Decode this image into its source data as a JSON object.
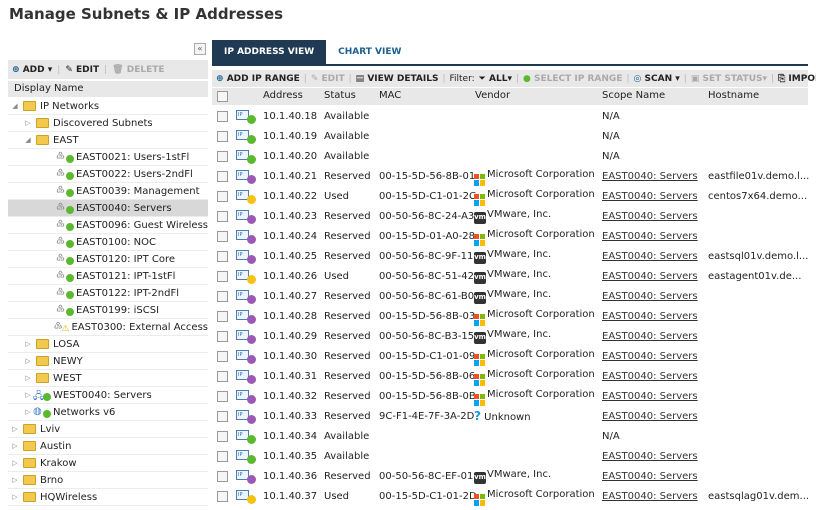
{
  "title": "Manage Subnets & IP Addresses",
  "colors": {
    "available": "#5cb82e",
    "reserved": "#9b59b6",
    "used": "#f5c211",
    "header_dark": "#1f3a52"
  },
  "left": {
    "collapse": "«",
    "toolbar": {
      "add": "ADD",
      "edit": "EDIT",
      "delete": "DELETE"
    },
    "column": "Display Name",
    "tree": [
      {
        "label": "IP Networks",
        "level": 0,
        "type": "folder",
        "expanded": true
      },
      {
        "label": "Discovered Subnets",
        "level": 1,
        "type": "folder"
      },
      {
        "label": "EAST",
        "level": 1,
        "type": "folder",
        "expanded": true
      },
      {
        "label": "EAST0021: Users-1stFl",
        "level": 2,
        "type": "subnet",
        "status": "ok"
      },
      {
        "label": "EAST0022: Users-2ndFl",
        "level": 2,
        "type": "subnet",
        "status": "ok"
      },
      {
        "label": "EAST0039: Management",
        "level": 2,
        "type": "subnet",
        "status": "ok"
      },
      {
        "label": "EAST0040: Servers",
        "level": 2,
        "type": "subnet",
        "status": "ok",
        "selected": true
      },
      {
        "label": "EAST0096: Guest Wireless",
        "level": 2,
        "type": "subnet",
        "status": "ok"
      },
      {
        "label": "EAST0100: NOC",
        "level": 2,
        "type": "subnet",
        "status": "ok"
      },
      {
        "label": "EAST0120: IPT Core",
        "level": 2,
        "type": "subnet",
        "status": "ok"
      },
      {
        "label": "EAST0121: IPT-1stFl",
        "level": 2,
        "type": "subnet",
        "status": "ok"
      },
      {
        "label": "EAST0122: IPT-2ndFl",
        "level": 2,
        "type": "subnet",
        "status": "ok"
      },
      {
        "label": "EAST0199: iSCSI",
        "level": 2,
        "type": "subnet",
        "status": "ok"
      },
      {
        "label": "EAST0300: External Access",
        "level": 2,
        "type": "subnet",
        "status": "warning"
      },
      {
        "label": "LOSA",
        "level": 1,
        "type": "folder"
      },
      {
        "label": "NEWY",
        "level": 1,
        "type": "folder"
      },
      {
        "label": "WEST",
        "level": 1,
        "type": "folder"
      },
      {
        "label": "WEST0040: Servers",
        "level": 1,
        "type": "server",
        "status": "ok"
      },
      {
        "label": "Networks v6",
        "level": 1,
        "type": "globe",
        "status": "ok"
      },
      {
        "label": "Lviv",
        "level": 0,
        "type": "folder"
      },
      {
        "label": "Austin",
        "level": 0,
        "type": "folder"
      },
      {
        "label": "Krakow",
        "level": 0,
        "type": "folder"
      },
      {
        "label": "Brno",
        "level": 0,
        "type": "folder"
      },
      {
        "label": "HQWireless",
        "level": 0,
        "type": "folder"
      }
    ]
  },
  "tabs": [
    "IP ADDRESS VIEW",
    "CHART VIEW"
  ],
  "toolbar": {
    "add_range": "ADD IP RANGE",
    "edit": "EDIT",
    "view_details": "VIEW DETAILS",
    "filter_label": "Filter:",
    "filter_value": "ALL",
    "select_range": "SELECT IP RANGE",
    "scan": "SCAN",
    "set_status": "SET STATUS",
    "import": "IMPORT"
  },
  "columns": [
    "Address",
    "Status",
    "MAC",
    "Vendor",
    "Scope Name",
    "Hostname"
  ],
  "rows": [
    {
      "address": "10.1.40.18",
      "status": "Available",
      "mac": "",
      "vendor": "",
      "vendor_icon": "",
      "scope": "N/A",
      "hostname": ""
    },
    {
      "address": "10.1.40.19",
      "status": "Available",
      "mac": "",
      "vendor": "",
      "vendor_icon": "",
      "scope": "N/A",
      "hostname": ""
    },
    {
      "address": "10.1.40.20",
      "status": "Available",
      "mac": "",
      "vendor": "",
      "vendor_icon": "",
      "scope": "N/A",
      "hostname": ""
    },
    {
      "address": "10.1.40.21",
      "status": "Reserved",
      "mac": "00-15-5D-56-8B-01",
      "vendor": "Microsoft Corporation",
      "vendor_icon": "microsoft",
      "scope": "EAST0040: Servers",
      "hostname": "eastfile01v.demo.l..."
    },
    {
      "address": "10.1.40.22",
      "status": "Used",
      "mac": "00-15-5D-C1-01-2C",
      "vendor": "Microsoft Corporation",
      "vendor_icon": "microsoft",
      "scope": "EAST0040: Servers",
      "hostname": "centos7x64.demo..."
    },
    {
      "address": "10.1.40.23",
      "status": "Reserved",
      "mac": "00-50-56-8C-24-A3",
      "vendor": "VMware, Inc.",
      "vendor_icon": "vmware",
      "scope": "EAST0040: Servers",
      "hostname": ""
    },
    {
      "address": "10.1.40.24",
      "status": "Reserved",
      "mac": "00-15-5D-01-A0-28",
      "vendor": "Microsoft Corporation",
      "vendor_icon": "microsoft",
      "scope": "EAST0040: Servers",
      "hostname": ""
    },
    {
      "address": "10.1.40.25",
      "status": "Reserved",
      "mac": "00-50-56-8C-9F-11",
      "vendor": "VMware, Inc.",
      "vendor_icon": "vmware",
      "scope": "EAST0040: Servers",
      "hostname": "eastsql01v.demo.l..."
    },
    {
      "address": "10.1.40.26",
      "status": "Used",
      "mac": "00-50-56-8C-51-42",
      "vendor": "VMware, Inc.",
      "vendor_icon": "vmware",
      "scope": "EAST0040: Servers",
      "hostname": "eastagent01v.de..."
    },
    {
      "address": "10.1.40.27",
      "status": "Reserved",
      "mac": "00-50-56-8C-61-B0",
      "vendor": "VMware, Inc.",
      "vendor_icon": "vmware",
      "scope": "EAST0040: Servers",
      "hostname": ""
    },
    {
      "address": "10.1.40.28",
      "status": "Reserved",
      "mac": "00-15-5D-56-8B-03",
      "vendor": "Microsoft Corporation",
      "vendor_icon": "microsoft",
      "scope": "EAST0040: Servers",
      "hostname": ""
    },
    {
      "address": "10.1.40.29",
      "status": "Reserved",
      "mac": "00-50-56-8C-B3-15",
      "vendor": "VMware, Inc.",
      "vendor_icon": "vmware",
      "scope": "EAST0040: Servers",
      "hostname": ""
    },
    {
      "address": "10.1.40.30",
      "status": "Reserved",
      "mac": "00-15-5D-C1-01-09",
      "vendor": "Microsoft Corporation",
      "vendor_icon": "microsoft",
      "scope": "EAST0040: Servers",
      "hostname": ""
    },
    {
      "address": "10.1.40.31",
      "status": "Reserved",
      "mac": "00-15-5D-56-8B-06",
      "vendor": "Microsoft Corporation",
      "vendor_icon": "microsoft",
      "scope": "EAST0040: Servers",
      "hostname": ""
    },
    {
      "address": "10.1.40.32",
      "status": "Reserved",
      "mac": "00-15-5D-56-8B-0B",
      "vendor": "Microsoft Corporation",
      "vendor_icon": "microsoft",
      "scope": "EAST0040: Servers",
      "hostname": ""
    },
    {
      "address": "10.1.40.33",
      "status": "Reserved",
      "mac": "9C-F1-4E-7F-3A-2D",
      "vendor": "Unknown",
      "vendor_icon": "unknown",
      "scope": "EAST0040: Servers",
      "hostname": ""
    },
    {
      "address": "10.1.40.34",
      "status": "Available",
      "mac": "",
      "vendor": "",
      "vendor_icon": "",
      "scope": "N/A",
      "hostname": ""
    },
    {
      "address": "10.1.40.35",
      "status": "Available",
      "mac": "",
      "vendor": "",
      "vendor_icon": "",
      "scope": "EAST0040: Servers",
      "hostname": ""
    },
    {
      "address": "10.1.40.36",
      "status": "Reserved",
      "mac": "00-50-56-8C-EF-01",
      "vendor": "VMware, Inc.",
      "vendor_icon": "vmware",
      "scope": "EAST0040: Servers",
      "hostname": ""
    },
    {
      "address": "10.1.40.37",
      "status": "Used",
      "mac": "00-15-5D-C1-01-2D",
      "vendor": "Microsoft Corporation",
      "vendor_icon": "microsoft",
      "scope": "EAST0040: Servers",
      "hostname": "eastsqlag01v.dem..."
    }
  ]
}
